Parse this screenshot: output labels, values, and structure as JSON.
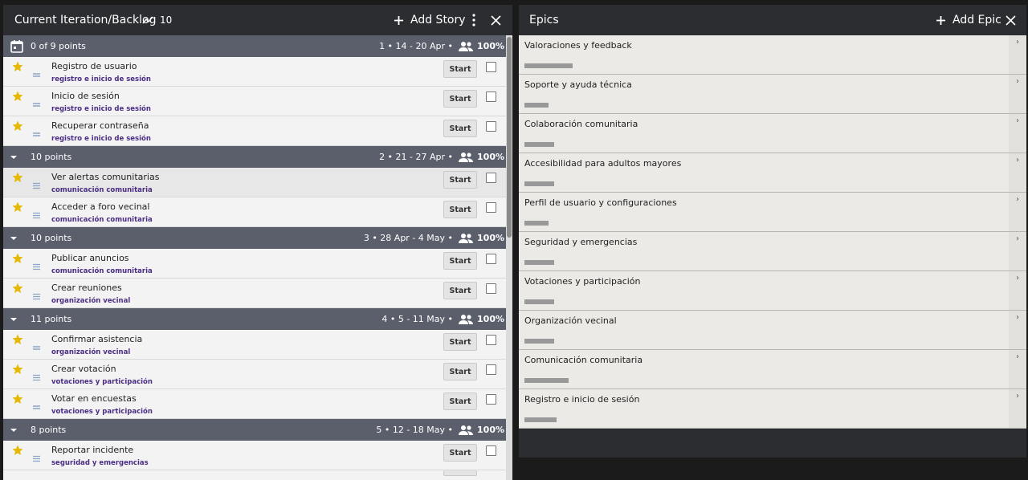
{
  "backlog": {
    "title": "Current Iteration/Backlog",
    "velocity": "10",
    "add_story_label": "Add Story",
    "groups": [
      {
        "points": "0 of 9 points",
        "dates": "1 • 14 - 20 Apr •",
        "pct": "100%",
        "current": true
      },
      {
        "points": "10 points",
        "dates": "2 • 21 - 27 Apr •",
        "pct": "100%"
      },
      {
        "points": "10 points",
        "dates": "3 • 28 Apr - 4 May •",
        "pct": "100%"
      },
      {
        "points": "11 points",
        "dates": "4 • 5 - 11 May •",
        "pct": "100%"
      },
      {
        "points": "8 points",
        "dates": "5 • 12 - 18 May •",
        "pct": "100%"
      }
    ],
    "stories": [
      {
        "title": "Registro de usuario",
        "label": "registro e inicio de sesión",
        "start": "Start"
      },
      {
        "title": "Inicio de sesión",
        "label": "registro e inicio de sesión",
        "start": "Start"
      },
      {
        "title": "Recuperar contraseña",
        "label": "registro e inicio de sesión",
        "start": "Start"
      },
      {
        "title": "Ver alertas comunitarias",
        "label": "comunicación comunitaria",
        "start": "Start"
      },
      {
        "title": "Acceder a foro vecinal",
        "label": "comunicación comunitaria",
        "start": "Start"
      },
      {
        "title": "Publicar anuncios",
        "label": "comunicación comunitaria",
        "start": "Start"
      },
      {
        "title": "Crear reuniones",
        "label": "organización vecinal",
        "start": "Start"
      },
      {
        "title": "Confirmar asistencia",
        "label": "organización vecinal",
        "start": "Start"
      },
      {
        "title": "Crear votación",
        "label": "votaciones y participación",
        "start": "Start"
      },
      {
        "title": "Votar en encuestas",
        "label": "votaciones y participación",
        "start": "Start"
      },
      {
        "title": "Reportar incidente",
        "label": "seguridad y emergencias",
        "start": "Start"
      }
    ]
  },
  "epics": {
    "title": "Epics",
    "add_epic_label": "Add Epic",
    "items": [
      {
        "title": "Valoraciones y feedback",
        "progress": 0.6
      },
      {
        "title": "Soporte y ayuda técnica",
        "progress": 0.3
      },
      {
        "title": "Colaboración comunitaria",
        "progress": 0.37
      },
      {
        "title": "Accesibilidad para adultos mayores",
        "progress": 0.37
      },
      {
        "title": "Perfil de usuario y configuraciones",
        "progress": 0.3
      },
      {
        "title": "Seguridad y emergencias",
        "progress": 0.37
      },
      {
        "title": "Votaciones y participación",
        "progress": 0.37
      },
      {
        "title": "Organización vecinal",
        "progress": 0.37
      },
      {
        "title": "Comunicación comunitaria",
        "progress": 0.55
      },
      {
        "title": "Registro e inicio de sesión",
        "progress": 0.4
      }
    ]
  },
  "colors": {
    "header_bg": "#2b2d31",
    "group_bg": "#5a5f6b",
    "label_purple": "#4b2e83",
    "star": "#e6b800"
  }
}
